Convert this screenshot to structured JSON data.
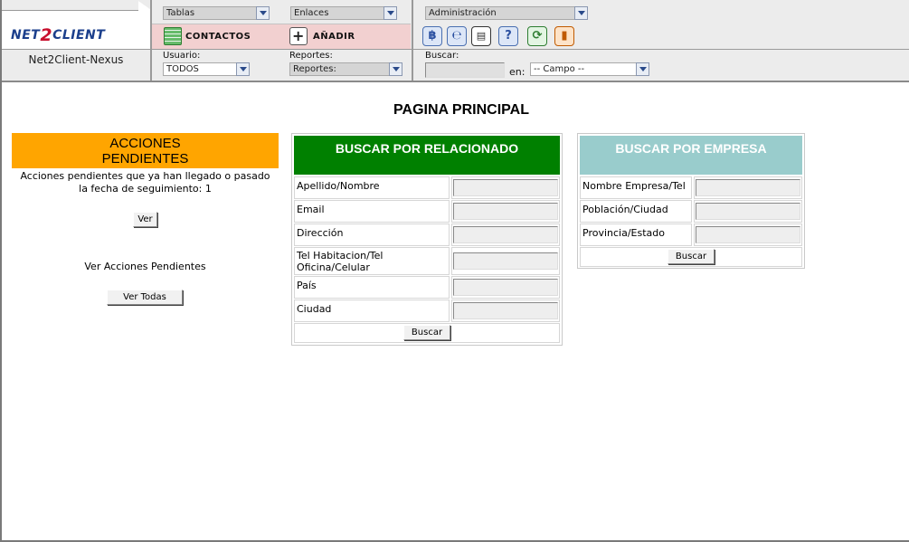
{
  "app": {
    "logo_pre": "NET",
    "logo_two": "2",
    "logo_post": "CLIENT",
    "name": "Net2Client-Nexus"
  },
  "nav": {
    "tablas": "Tablas",
    "enlaces": "Enlaces",
    "administracion": "Administración",
    "contactos": "CONTACTOS",
    "anadir": "AÑADIR"
  },
  "filters": {
    "usuario_label": "Usuario:",
    "usuario_value": "TODOS",
    "reportes_label": "Reportes:",
    "reportes_value": "Reportes:",
    "buscar_label": "Buscar:",
    "en_label": "en:",
    "campo_value": "-- Campo --"
  },
  "toolbar_icons": [
    "bitcoin-icon",
    "script-icon",
    "id-card-icon",
    "help-icon",
    "refresh-icon",
    "exit-icon"
  ],
  "main": {
    "title": "PAGINA PRINCIPAL",
    "acciones": {
      "title": "ACCIONES PENDIENTES",
      "text": "Acciones pendientes que ya han llegado o pasado la fecha de seguimiento: 1",
      "ver_button": "Ver",
      "link_text": "Ver Acciones Pendientes",
      "ver_todas_button": "Ver Todas",
      "color": "#ffa500"
    },
    "relacionado": {
      "title": "BUSCAR POR RELACIONADO",
      "color": "#008000",
      "fields": [
        "Apellido/Nombre",
        "Email",
        "Dirección",
        "Tel Habitacion/Tel Oficina/Celular",
        "País",
        "Ciudad"
      ],
      "button": "Buscar"
    },
    "empresa": {
      "title": "BUSCAR POR EMPRESA",
      "color": "#99cccc",
      "fields": [
        "Nombre Empresa/Tel",
        "Población/Ciudad",
        "Provincia/Estado"
      ],
      "button": "Buscar"
    }
  }
}
